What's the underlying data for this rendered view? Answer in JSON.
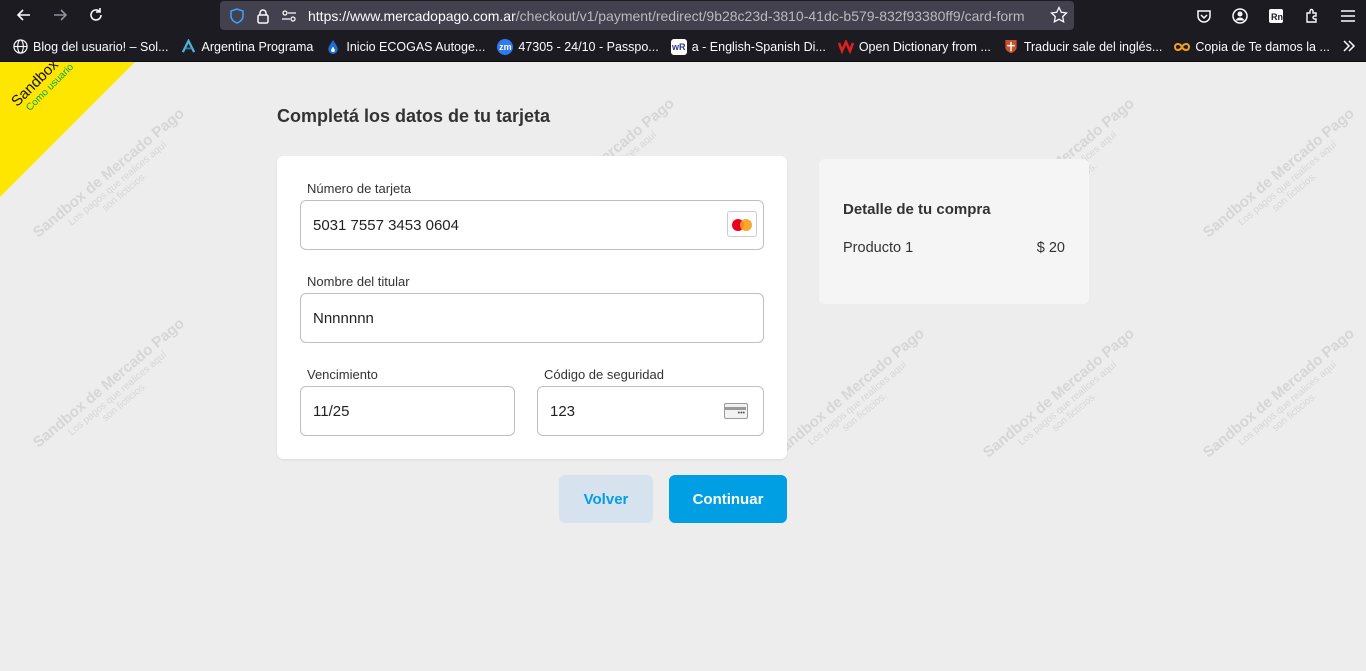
{
  "browser": {
    "url_host": "https://www.mercadopago.com.ar",
    "url_path": "/checkout/v1/payment/redirect/9b28c23d-3810-41dc-b579-832f93380ff9/card-form",
    "bookmarks": [
      {
        "label": "Blog del usuario! – Sol...",
        "icon": "globe-icon",
        "color": "#fbfbfe"
      },
      {
        "label": "Argentina Programa",
        "icon": "argentina-programa-icon",
        "color": "#4fb3d9"
      },
      {
        "label": "Inicio ECOGAS Autoge...",
        "icon": "ecogas-icon",
        "color": "#1d6fd0"
      },
      {
        "label": "47305 - 24/10 - Passpo...",
        "icon": "zm-icon",
        "color": "#2d7bf0"
      },
      {
        "label": "a - English-Spanish Di...",
        "icon": "wr-icon",
        "color": "#ffffff"
      },
      {
        "label": "Open Dictionary from ...",
        "icon": "dictionary-icon",
        "color": "#e02020"
      },
      {
        "label": "Traducir sale del inglés...",
        "icon": "cambridge-icon",
        "color": "#c8502a"
      },
      {
        "label": "Copia de Te damos la ...",
        "icon": "infinity-icon",
        "color": "#f0a020"
      }
    ]
  },
  "sandbox": {
    "title": "Sandbox",
    "subtitle": "Como usuario",
    "watermark_title": "Sandbox de Mercado Pago",
    "watermark_line1": "Los pagos que realices aquí",
    "watermark_line2": "son ficticios."
  },
  "form": {
    "heading": "Completá los datos de tu tarjeta",
    "card_number_label": "Número de tarjeta",
    "card_number_value": "5031 7557 3453 0604",
    "holder_label": "Nombre del titular",
    "holder_value": "Nnnnnnn",
    "expiry_label": "Vencimiento",
    "expiry_value": "11/25",
    "cvv_label": "Código de seguridad",
    "cvv_value": "123",
    "back_label": "Volver",
    "continue_label": "Continuar"
  },
  "summary": {
    "title": "Detalle de tu compra",
    "item_label": "Producto 1",
    "item_price": "$ 20"
  },
  "colors": {
    "accent": "#009ee3",
    "sandbox_yellow": "#ffe600"
  }
}
